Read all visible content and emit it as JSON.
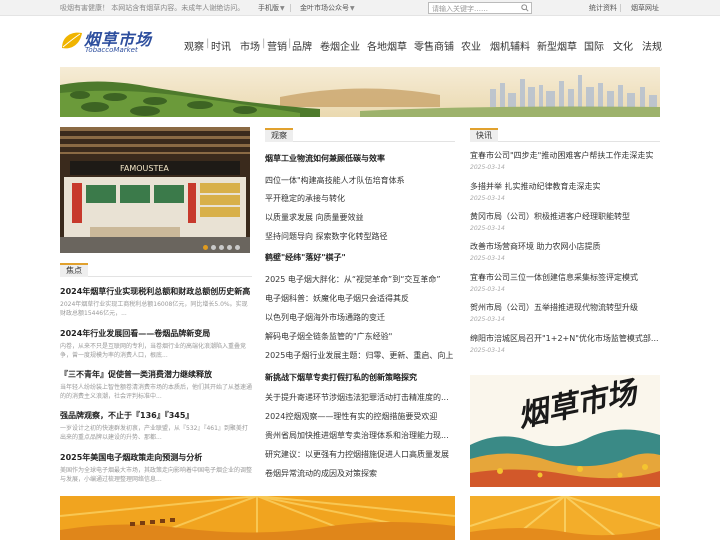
{
  "topbar": {
    "notice": "吸烟有害健康！ 本网站含有烟草内容。未成年人谢绝访问。",
    "mobile_label": "手机版",
    "wechat_label": "金叶市场公众号",
    "search_placeholder": "请输入关键字……",
    "stats_link": "统计资料",
    "tobacco_link": "烟草网址"
  },
  "logo": {
    "cn": "烟草市场",
    "en": "TobaccoMarket"
  },
  "nav": [
    "观察",
    "时讯",
    "市场",
    "营销",
    "品牌",
    "卷烟企业",
    "各地烟草",
    "零售商铺",
    "农业",
    "烟机辅料",
    "新型烟草",
    "国际",
    "文化",
    "法规"
  ],
  "slide": {
    "store_sign": "FAMOUSTEA",
    "dot_count": 5,
    "active_dot": 1
  },
  "focus": {
    "label": "焦点",
    "items": [
      {
        "title": "2024年烟草行业实现税利总额和财政总额创历史新高",
        "desc": "2024年烟草行业实现工商税利总额16008亿元，同比增长5.0%。实现财政总额15446亿元，..."
      },
      {
        "title": "2024年行业发展回看——卷烟品牌新变局",
        "desc": "内卷，从来不只是互联网的专利，当卷烟行业的高端化浪潮陷入重叠竞争，曾一度规模为率的消费人口，根底..."
      },
      {
        "title": "『三不青年』促使普一类消费潜力继续释放",
        "desc": "当年轻人纷纷装上智性额卷清消费市场的本质后，他们其开始了从基速通的的消费主义浪潮，社会评判标准中..."
      },
      {
        "title": "强品牌观察，不止于『136』『345』",
        "desc": "一岁设计之初的快速群发初衷，产业联盟，从『532』『461』到聚美打出来的重点品牌以建设的升势、那都..."
      },
      {
        "title": "2025年美国电子烟政策走向预测与分析",
        "desc": "美国作为全球电子烟最大市场，其政策走向影响着中国电子烟企业的调整与发展，小编通过梳理整理网络信息..."
      }
    ]
  },
  "observe": {
    "label": "观察",
    "items": [
      {
        "text": "烟草工业物流如何兼顾低碳与效率",
        "bold": true
      },
      {
        "text": "四位一体\"构建高技能人才队伍培育体系",
        "bold": false
      },
      {
        "text": "平开稳定的承接与转化",
        "bold": false
      },
      {
        "text": "以质量求发展 向质量要效益",
        "bold": false
      },
      {
        "text": "坚持问题导向 探索数字化转型路径",
        "bold": false
      },
      {
        "text": "鹤壁\"经纬\"落好\"棋子\"",
        "bold": true
      },
      {
        "text": "2025 电子烟大胖化：从“视觉革命”到“交互革命”",
        "bold": false
      },
      {
        "text": "电子烟科普：妖魔化电子烟只会适得其反",
        "bold": false
      },
      {
        "text": "以色列电子烟海外市场通路的变迁",
        "bold": false
      },
      {
        "text": "解码电子烟全链条监管的\"广东经验\"",
        "bold": false
      },
      {
        "text": "2025电子烟行业发展主题：归零、更新、重启、向上",
        "bold": false
      },
      {
        "text": "新挑战下烟草专卖打假打私的创新策略探究",
        "bold": true
      },
      {
        "text": "关于提升寄递环节涉烟违法犯罪活动打击精准度的...",
        "bold": false
      },
      {
        "text": "2024控烟观察——理性有实的控烟措施要受欢迎",
        "bold": false
      },
      {
        "text": "贵州省局加快推进烟草专卖治理体系和治理能力现...",
        "bold": false
      },
      {
        "text": "研究建议：以更强有力控烟措施促进人口高质量发展",
        "bold": false
      },
      {
        "text": "卷烟异常流动的成因及对策探索",
        "bold": false
      }
    ]
  },
  "news": {
    "label": "快讯",
    "items": [
      {
        "title": "宜春市公司\"四步走\"推动困难客户帮扶工作走深走实",
        "date": "2025-03-14"
      },
      {
        "title": "多措并举 扎实推动纪律教育走深走实",
        "date": "2025-03-14"
      },
      {
        "title": "黄冈市局（公司）积极推进客户经理职能转型",
        "date": "2025-03-14"
      },
      {
        "title": "改善市场营商环境 助力农网小店提质",
        "date": "2025-03-14"
      },
      {
        "title": "宜春市公司三位一体创建信息采集标签评定模式",
        "date": "2025-03-14"
      },
      {
        "title": "贺州市局（公司）五举措推进现代物流转型升级",
        "date": "2025-03-14"
      },
      {
        "title": "绵阳市涪城区局召开\"1+2+N\"优化市场监管模式部...",
        "date": "2025-03-14"
      }
    ]
  },
  "poster": {
    "title": "烟草市场"
  },
  "colors": {
    "accent": "#e1a12e",
    "logo_blue": "#2e4f9e",
    "sky": "#f0e4c6"
  }
}
